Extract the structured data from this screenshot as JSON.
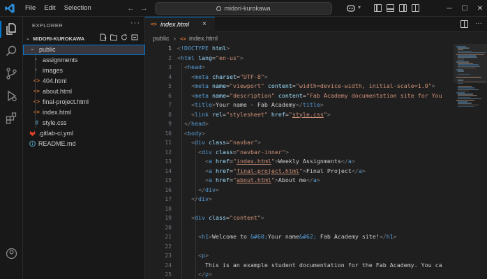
{
  "window": {
    "menu": [
      "File",
      "Edit",
      "Selection"
    ],
    "search_text": "midori-kurokawa",
    "controls": {
      "minimize": "─",
      "maximize": "☐",
      "close": "✕"
    }
  },
  "sidebar": {
    "title": "EXPLORER",
    "more": "···",
    "root": "MIDORI-KUROKAWA",
    "tree": [
      {
        "label": "public",
        "icon": "chevron-down-icon",
        "depth": 0
      },
      {
        "label": "assignments",
        "icon": "chevron-right-icon",
        "depth": 1
      },
      {
        "label": "images",
        "icon": "chevron-right-icon",
        "depth": 1
      },
      {
        "label": "404.html",
        "icon": "html-file-icon",
        "depth": 1
      },
      {
        "label": "about.html",
        "icon": "html-file-icon",
        "depth": 1
      },
      {
        "label": "final-project.html",
        "icon": "html-file-icon",
        "depth": 1
      },
      {
        "label": "index.html",
        "icon": "html-file-icon",
        "depth": 1
      },
      {
        "label": "style.css",
        "icon": "css-file-icon",
        "depth": 1
      },
      {
        "label": ".gitlab-ci.yml",
        "icon": "gitlab-file-icon",
        "depth": 0
      },
      {
        "label": "README.md",
        "icon": "info-file-icon",
        "depth": 0
      }
    ]
  },
  "editor": {
    "tab": {
      "label": "index.html",
      "close": "×"
    },
    "breadcrumb": {
      "folder": "public",
      "file": "index.html",
      "sep": "›"
    },
    "current_line": 1,
    "line_numbers": [
      "1",
      "2",
      "3",
      "4",
      "5",
      "6",
      "7",
      "8",
      "9",
      "10",
      "11",
      "12",
      "13",
      "14",
      "15",
      "16",
      "17",
      "18",
      "19",
      "20",
      "21",
      "22",
      "23",
      "24",
      "25",
      "26"
    ]
  },
  "colors": {
    "accent": "#0078d4",
    "tag": "#569cd6",
    "attribute": "#9cdcfe",
    "string": "#ce9178",
    "html_icon": "#e37933",
    "css_icon": "#519aba",
    "gitlab_icon": "#e24329"
  }
}
